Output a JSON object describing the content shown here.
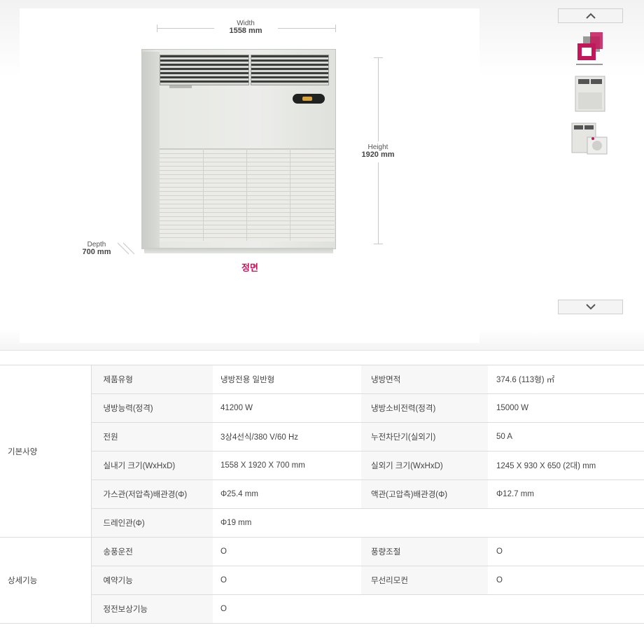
{
  "viewer": {
    "dimensions": {
      "width_label": "Width",
      "width_value": "1558 mm",
      "height_label": "Height",
      "height_value": "1920 mm",
      "depth_label": "Depth",
      "depth_value": "700 mm"
    },
    "caption": "정면",
    "accent_color": "#c2185b",
    "thumb_nav": {
      "up_icon": "chevron-up-icon",
      "down_icon": "chevron-down-icon"
    }
  },
  "spec": {
    "sections": [
      {
        "category": "기본사양",
        "rows": [
          [
            {
              "label": "제품유형",
              "value": "냉방전용 일반형"
            },
            {
              "label": "냉방면적",
              "value": "374.6 (113형) ㎡"
            }
          ],
          [
            {
              "label": "냉방능력(정격)",
              "value": "41200 W"
            },
            {
              "label": "냉방소비전력(정격)",
              "value": "15000 W"
            }
          ],
          [
            {
              "label": "전원",
              "value": "3상4선식/380 V/60 Hz"
            },
            {
              "label": "누전차단기(실외기)",
              "value": "50 A"
            }
          ],
          [
            {
              "label": "실내기 크기(WxHxD)",
              "value": "1558 X 1920 X 700 mm"
            },
            {
              "label": "실외기 크기(WxHxD)",
              "value": "1245 X 930 X 650 (2대) mm"
            }
          ],
          [
            {
              "label": "가스관(저압측)배관경(Φ)",
              "value": "Φ25.4 mm"
            },
            {
              "label": "액관(고압측)배관경(Φ)",
              "value": "Φ12.7 mm"
            }
          ],
          [
            {
              "label": "드레인관(Φ)",
              "value": "Φ19 mm"
            },
            {
              "label": "",
              "value": ""
            }
          ]
        ]
      },
      {
        "category": "상세기능",
        "rows": [
          [
            {
              "label": "송풍운전",
              "value": "O"
            },
            {
              "label": "풍량조절",
              "value": "O"
            }
          ],
          [
            {
              "label": "예약기능",
              "value": "O"
            },
            {
              "label": "무선리모컨",
              "value": "O"
            }
          ],
          [
            {
              "label": "정전보상기능",
              "value": "O"
            },
            {
              "label": "",
              "value": ""
            }
          ]
        ]
      }
    ]
  }
}
